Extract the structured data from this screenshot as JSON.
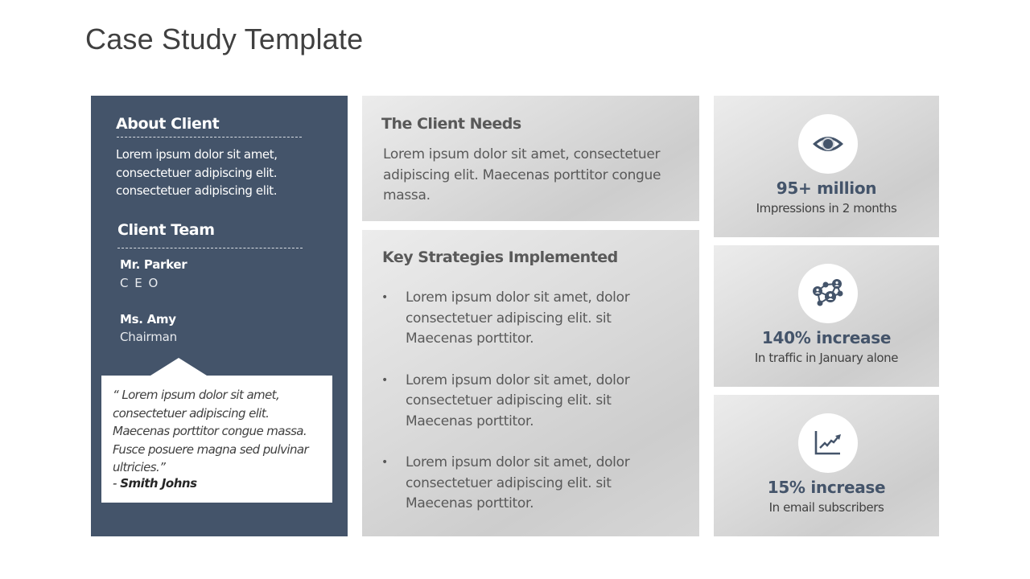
{
  "slide": {
    "title": "Case Study Template"
  },
  "colors": {
    "panel_dark": "#44546a",
    "accent_text": "#44546a",
    "card_gray": "#d6d6d6",
    "body_text": "#595959"
  },
  "about_client": {
    "heading": "About Client",
    "lines": [
      "Lorem ipsum dolor sit amet,",
      "consectetuer adipiscing elit.",
      "consectetuer adipiscing elit."
    ]
  },
  "client_team": {
    "heading": "Client Team",
    "members": [
      {
        "name": "Mr.  Parker",
        "role": "C E O"
      },
      {
        "name": "Ms. Amy",
        "role": "Chairman"
      }
    ]
  },
  "testimonial": {
    "lines": [
      "“ Lorem ipsum dolor sit amet,",
      "consectetuer adipiscing elit.",
      "Maecenas porttitor congue massa.",
      "Fusce posuere magna sed pulvinar",
      "ultricies.”"
    ],
    "author_prefix": "- ",
    "author": "Smith Johns"
  },
  "client_needs": {
    "heading": "The Client Needs",
    "lines": [
      "Lorem ipsum dolor sit amet, consectetuer",
      "adipiscing elit. Maecenas porttitor congue",
      "massa."
    ]
  },
  "key_strategies": {
    "heading": "Key Strategies Implemented",
    "bullet_glyph": "•",
    "items": [
      {
        "lines": [
          "Lorem ipsum dolor sit amet, dolor",
          "consectetuer  adipiscing elit. sit",
          "Maecenas  porttitor."
        ]
      },
      {
        "lines": [
          "Lorem ipsum dolor sit amet, dolor",
          "consectetuer  adipiscing elit. sit",
          "Maecenas  porttitor."
        ]
      },
      {
        "lines": [
          "Lorem ipsum dolor sit amet, dolor",
          "consectetuer  adipiscing elit. sit",
          "Maecenas  porttitor."
        ]
      }
    ]
  },
  "stats": [
    {
      "icon": "eye-icon",
      "value": "95+ million",
      "label": "Impressions in 2 months"
    },
    {
      "icon": "network-icon",
      "value": "140% increase",
      "label": "In traffic in January alone"
    },
    {
      "icon": "growth-chart-icon",
      "value": "15% increase",
      "label": "In email subscribers"
    }
  ]
}
